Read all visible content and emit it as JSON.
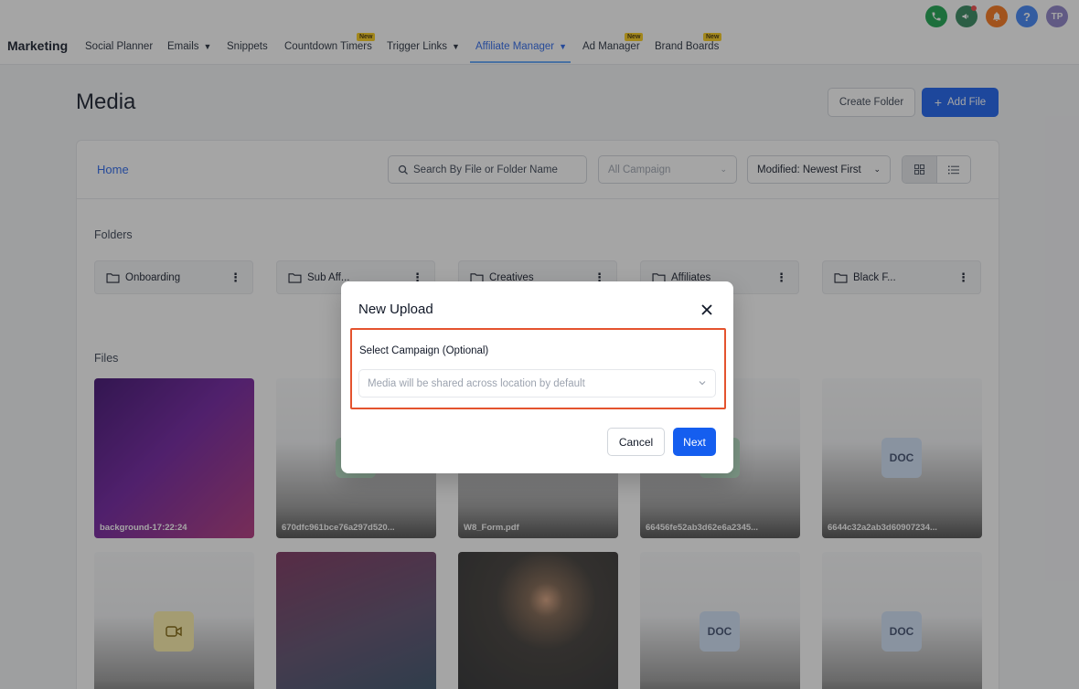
{
  "nav": {
    "brand": "Marketing",
    "items": [
      {
        "label": "Social Planner"
      },
      {
        "label": "Emails"
      },
      {
        "label": "Snippets"
      },
      {
        "label": "Countdown Timers"
      },
      {
        "label": "Trigger Links"
      },
      {
        "label": "Affiliate Manager"
      },
      {
        "label": "Ad Manager"
      },
      {
        "label": "Brand Boards"
      }
    ],
    "new_badge": "New",
    "avatar_initials": "TP",
    "colors": {
      "phone": "#16a34a",
      "megaphone": "#2f855a",
      "bell": "#f97316",
      "help": "#3b82f6",
      "avatar": "#8b7fc7"
    }
  },
  "page": {
    "title": "Media",
    "create_folder": "Create Folder",
    "add_file": "Add File"
  },
  "toolbar": {
    "home": "Home",
    "search_placeholder": "Search By File or Folder Name",
    "campaign_filter": "All Campaign",
    "sort": "Modified: Newest First"
  },
  "folders": {
    "label": "Folders",
    "items": [
      {
        "name": "Onboarding"
      },
      {
        "name": "Sub Aff..."
      },
      {
        "name": "Creatives"
      },
      {
        "name": "Affiliates"
      },
      {
        "name": "Black F..."
      }
    ]
  },
  "files": {
    "label": "Files",
    "row1": [
      {
        "name": "background-17:22:24"
      },
      {
        "name": "670dfc961bce76a297d520..."
      },
      {
        "name": "W8_Form.pdf"
      },
      {
        "name": "66456fe52ab3d62e6a2345..."
      },
      {
        "name": "6644c32a2ab3d60907234...",
        "badge": "DOC"
      }
    ],
    "row2_badges": [
      "DOC",
      "DOC"
    ]
  },
  "modal": {
    "title": "New Upload",
    "campaign_label": "Select Campaign (Optional)",
    "campaign_placeholder": "Media will be shared across location by default",
    "cancel": "Cancel",
    "next": "Next"
  }
}
